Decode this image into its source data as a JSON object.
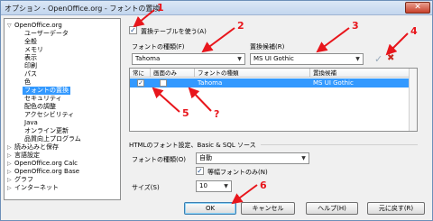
{
  "window": {
    "title": "オプション - OpenOffice.org - フォントの置換",
    "close": "✕"
  },
  "tree": {
    "items": [
      {
        "label": "OpenOffice.org",
        "expander": "▽"
      },
      {
        "label": "ユーザーデータ"
      },
      {
        "label": "全般"
      },
      {
        "label": "メモリ"
      },
      {
        "label": "表示"
      },
      {
        "label": "印刷"
      },
      {
        "label": "パス"
      },
      {
        "label": "色"
      },
      {
        "label": "フォントの置換"
      },
      {
        "label": "セキュリティ"
      },
      {
        "label": "配色の調整"
      },
      {
        "label": "アクセシビリティ"
      },
      {
        "label": "Java"
      },
      {
        "label": "オンライン更新"
      },
      {
        "label": "品質向上プログラム"
      },
      {
        "label": "読み込みと保存",
        "expander": "▷"
      },
      {
        "label": "言語設定",
        "expander": "▷"
      },
      {
        "label": "OpenOffice.org Calc",
        "expander": "▷"
      },
      {
        "label": "OpenOffice.org Base",
        "expander": "▷"
      },
      {
        "label": "グラフ",
        "expander": "▷"
      },
      {
        "label": "インターネット",
        "expander": "▷"
      }
    ]
  },
  "replacement": {
    "use_table_label": "置換テーブルを使う(A)",
    "font_label": "フォントの種類(F)",
    "replace_label": "置換候補(R)",
    "font_value": "Tahoma",
    "replace_value": "MS UI Gothic",
    "check_mark": "✓",
    "dropdown_glyph": "▼",
    "delete_glyph": "✖",
    "apply_glyph": "✓"
  },
  "table": {
    "headers": [
      "常に",
      "画面のみ",
      "フォントの種類",
      "置換候補"
    ],
    "rows": [
      {
        "always": "✓",
        "screen_only": "",
        "font": "Tahoma",
        "replace": "MS UI Gothic"
      }
    ]
  },
  "html_fonts": {
    "section_title": "HTMLのフォント設定、Basic & SQL ソース",
    "font_label": "フォントの種類(O)",
    "font_value": "自動",
    "monospace_label": "等幅フォントのみ(N)",
    "size_label": "サイズ(S)",
    "size_value": "10"
  },
  "buttons": {
    "ok": "OK",
    "cancel": "キャンセル",
    "help": "ヘルプ(H)",
    "reset": "元に戻す(R)"
  },
  "annotations": {
    "n1": "1",
    "n2": "2",
    "n3": "3",
    "n4": "4",
    "n5": "5",
    "nq": "?",
    "n6": "6"
  },
  "colors": {
    "accent": "#3399ff",
    "arrow": "#e8161c"
  }
}
